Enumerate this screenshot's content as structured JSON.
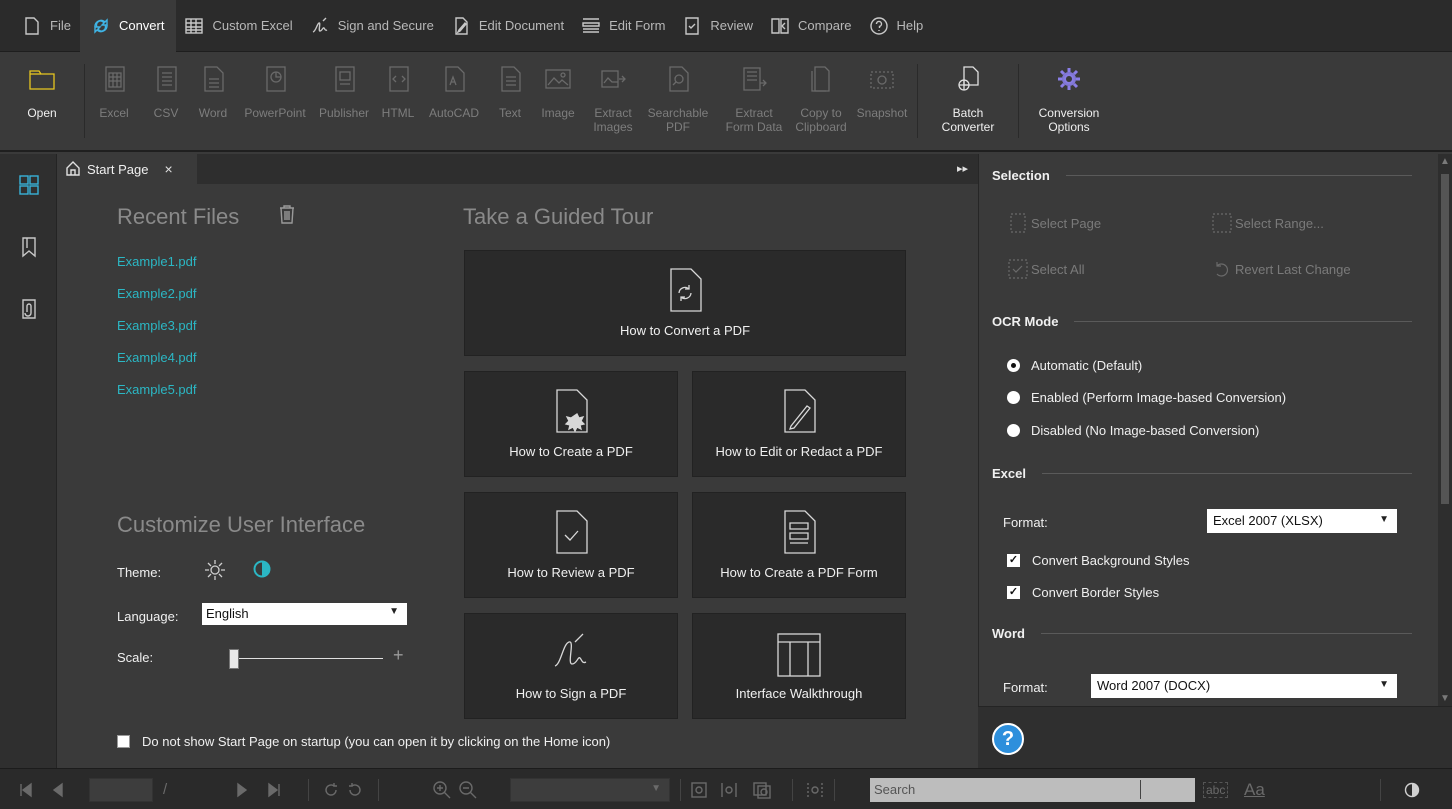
{
  "menu": {
    "items": [
      {
        "label": "File",
        "icon": "file-icon"
      },
      {
        "label": "Convert",
        "icon": "convert-icon",
        "active": true
      },
      {
        "label": "Custom Excel",
        "icon": "grid-icon"
      },
      {
        "label": "Sign and Secure",
        "icon": "signature-icon"
      },
      {
        "label": "Edit Document",
        "icon": "edit-document-icon"
      },
      {
        "label": "Edit Form",
        "icon": "form-icon"
      },
      {
        "label": "Review",
        "icon": "review-icon"
      },
      {
        "label": "Compare",
        "icon": "compare-icon"
      },
      {
        "label": "Help",
        "icon": "help-icon"
      }
    ]
  },
  "ribbon": {
    "open": "Open",
    "excel": "Excel",
    "csv": "CSV",
    "word": "Word",
    "powerpoint": "PowerPoint",
    "publisher": "Publisher",
    "html": "HTML",
    "autocad": "AutoCAD",
    "text": "Text",
    "image": "Image",
    "extract_images_1": "Extract",
    "extract_images_2": "Images",
    "searchable_pdf_1": "Searchable",
    "searchable_pdf_2": "PDF",
    "extract_form_1": "Extract",
    "extract_form_2": "Form Data",
    "copy_clip_1": "Copy to",
    "copy_clip_2": "Clipboard",
    "snapshot": "Snapshot",
    "batch_1": "Batch",
    "batch_2": "Converter",
    "conv_opt_1": "Conversion",
    "conv_opt_2": "Options"
  },
  "tab": {
    "label": "Start Page",
    "close": "×"
  },
  "start": {
    "recent_title": "Recent Files",
    "recent_files": [
      "Example1.pdf",
      "Example2.pdf",
      "Example3.pdf",
      "Example4.pdf",
      "Example5.pdf"
    ],
    "tour_title": "Take a Guided Tour",
    "tours": {
      "convert": "How to Convert a PDF",
      "create": "How to Create a PDF",
      "edit": "How to Edit or Redact a PDF",
      "review": "How to Review a PDF",
      "form": "How to Create a PDF Form",
      "sign": "How to Sign a PDF",
      "walkthrough": "Interface Walkthrough"
    },
    "custom_title": "Customize User Interface",
    "theme_label": "Theme:",
    "language_label": "Language:",
    "language_value": "English",
    "scale_label": "Scale:",
    "scale_plus": "+",
    "startup_text": "Do not show Start Page on startup (you can open it by clicking on the Home icon)"
  },
  "panel": {
    "selection_title": "Selection",
    "select_page": "Select Page",
    "select_range": "Select Range...",
    "select_all": "Select All",
    "revert": "Revert Last Change",
    "ocr_title": "OCR Mode",
    "ocr_auto": "Automatic (Default)",
    "ocr_enabled": "Enabled (Perform Image-based Conversion)",
    "ocr_disabled": "Disabled (No Image-based Conversion)",
    "excel_title": "Excel",
    "excel_format_label": "Format:",
    "excel_format_value": "Excel 2007 (XLSX)",
    "excel_bg": "Convert Background Styles",
    "excel_border": "Convert Border Styles",
    "word_title": "Word",
    "word_format_label": "Format:",
    "word_format_value": "Word 2007 (DOCX)"
  },
  "status": {
    "page_sep": "/",
    "search_placeholder": "Search",
    "font_label": "Aa",
    "abc_label": "abc"
  },
  "colors": {
    "accent_blue": "#3fb4e5",
    "link_teal": "#2bb7c4",
    "open_yellow": "#e6c620",
    "options_purple": "#8a7ee8",
    "help_blue": "#2d8fdc"
  }
}
